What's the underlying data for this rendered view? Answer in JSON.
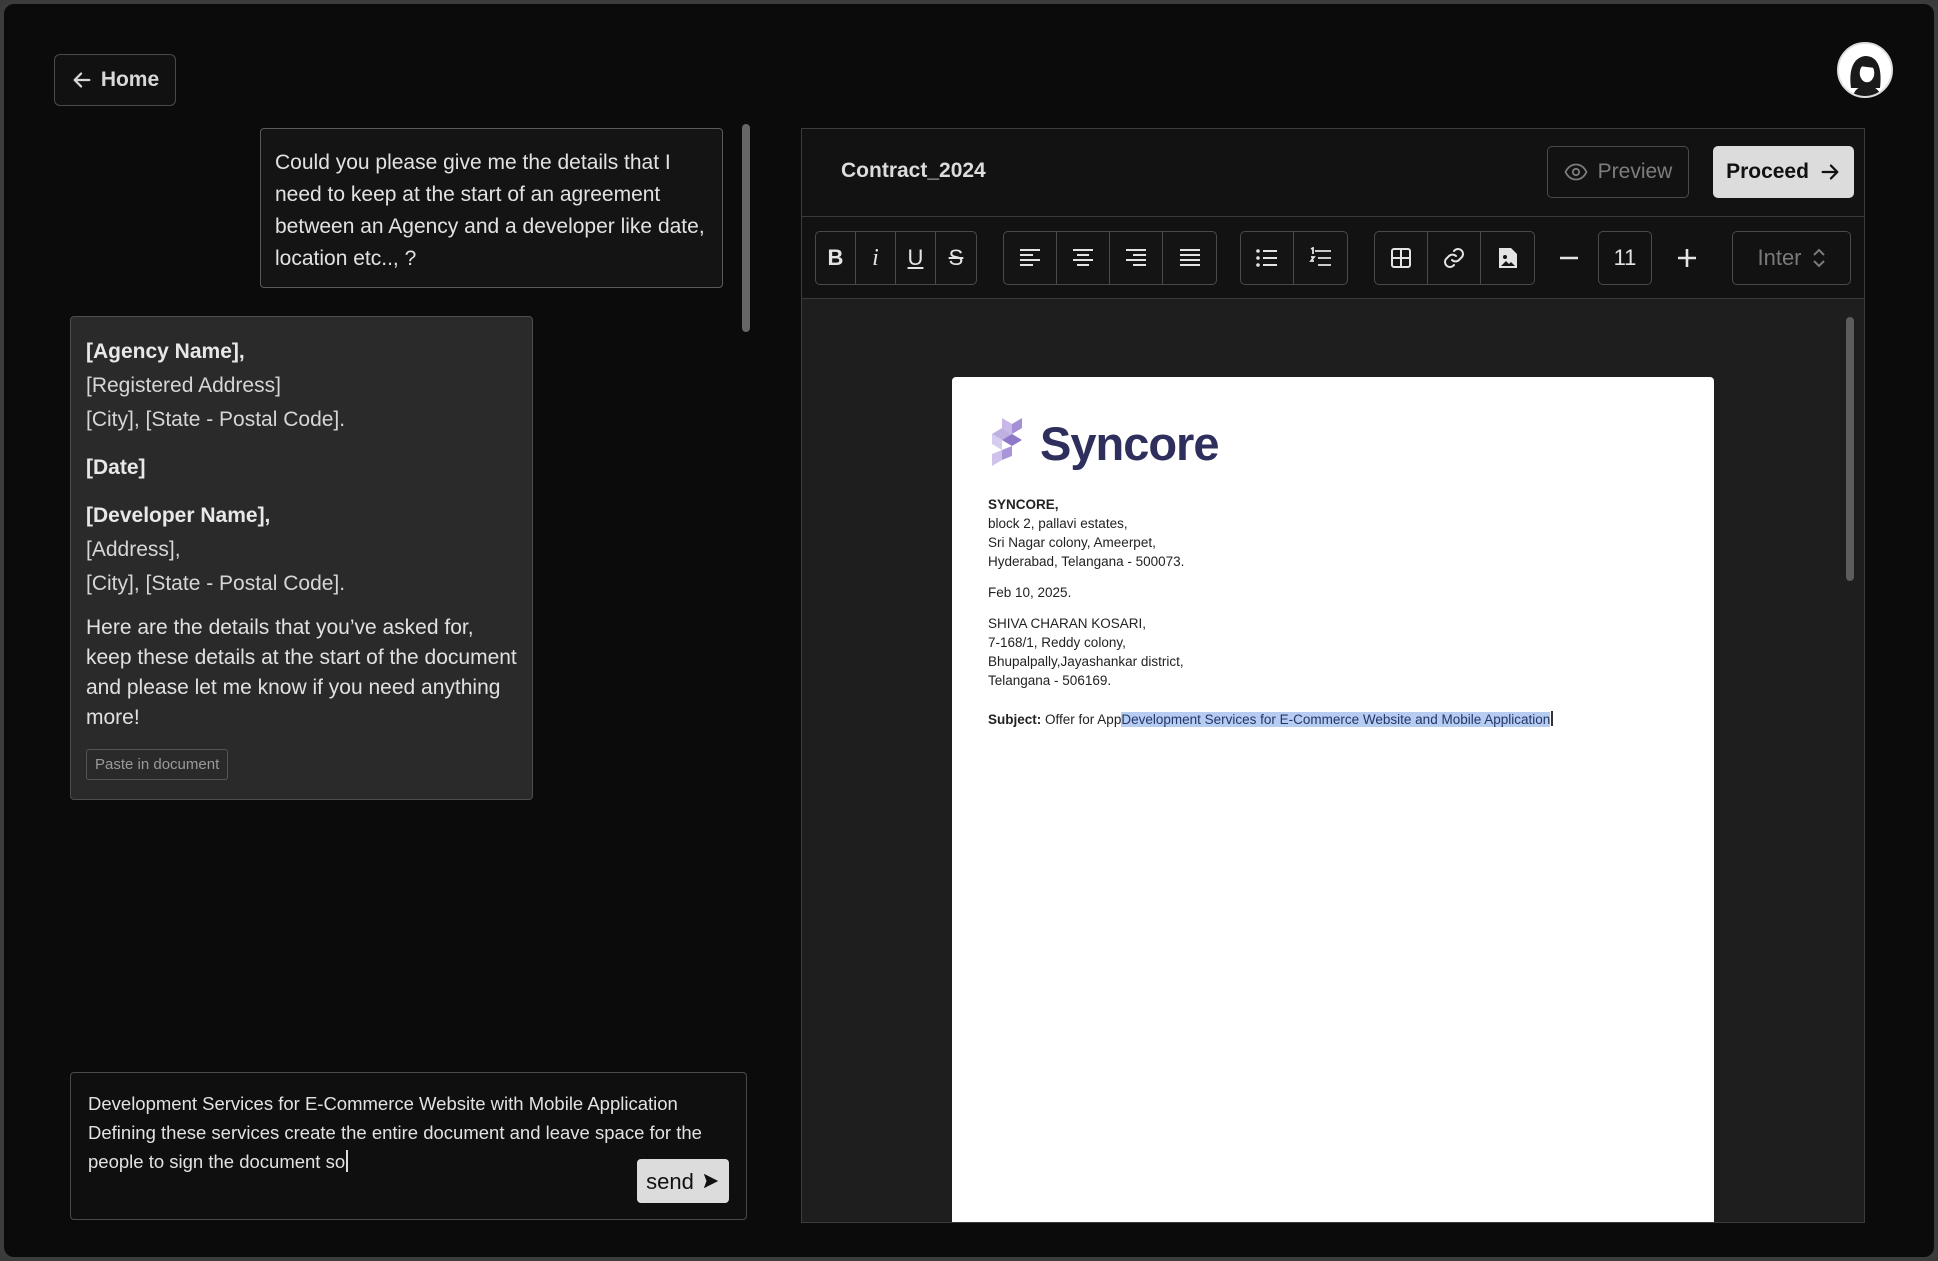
{
  "nav": {
    "home_label": "Home"
  },
  "chat": {
    "user_message": "Could you please give me the details that I need to keep at the start of an agreement between an Agency and a developer like date, location etc.., ?",
    "ai_response": {
      "agency_name": "[Agency Name],",
      "registered_address": "[Registered Address]",
      "agency_city": "[City], [State - Postal Code].",
      "date": "[Date]",
      "developer_name": "[Developer Name],",
      "developer_address": "[Address],",
      "developer_city": "[City], [State - Postal Code].",
      "note": "Here are the details that you’ve asked for, keep these details at the start of the document and please let me know if you need anything more!",
      "paste_button": "Paste in document"
    },
    "composer": {
      "value": "Development Services for E-Commerce Website with Mobile Application Defining these services create the entire document and leave space for the people to sign the document so",
      "send_label": "send"
    }
  },
  "editor": {
    "title": "Contract_2024",
    "preview_label": "Preview",
    "proceed_label": "Proceed",
    "toolbar": {
      "bold": "B",
      "italic": "i",
      "underline": "U",
      "strike": "S",
      "font_size": "11",
      "font_family": "Inter"
    },
    "document": {
      "logo_text": "Syncore",
      "sender": {
        "name": "SYNCORE,",
        "line1": "block 2, pallavi estates,",
        "line2": "Sri Nagar colony, Ameerpet,",
        "line3": "Hyderabad, Telangana  - 500073."
      },
      "date": "Feb 10, 2025.",
      "recipient": {
        "name": "SHIVA CHARAN KOSARI,",
        "line1": "7-168/1, Reddy colony,",
        "line2": "Bhupalpally,Jayashankar district,",
        "line3": "Telangana - 506169."
      },
      "subject_label": "Subject:",
      "subject_prefix": "Offer for App",
      "subject_highlight": "Development Services for E-Commerce Website and Mobile Application"
    }
  },
  "colors": {
    "background": "#0b0b0c",
    "accent_button": "#dcdcdc",
    "highlight": "#b6ccf0",
    "logo": "#2e2f5c"
  }
}
